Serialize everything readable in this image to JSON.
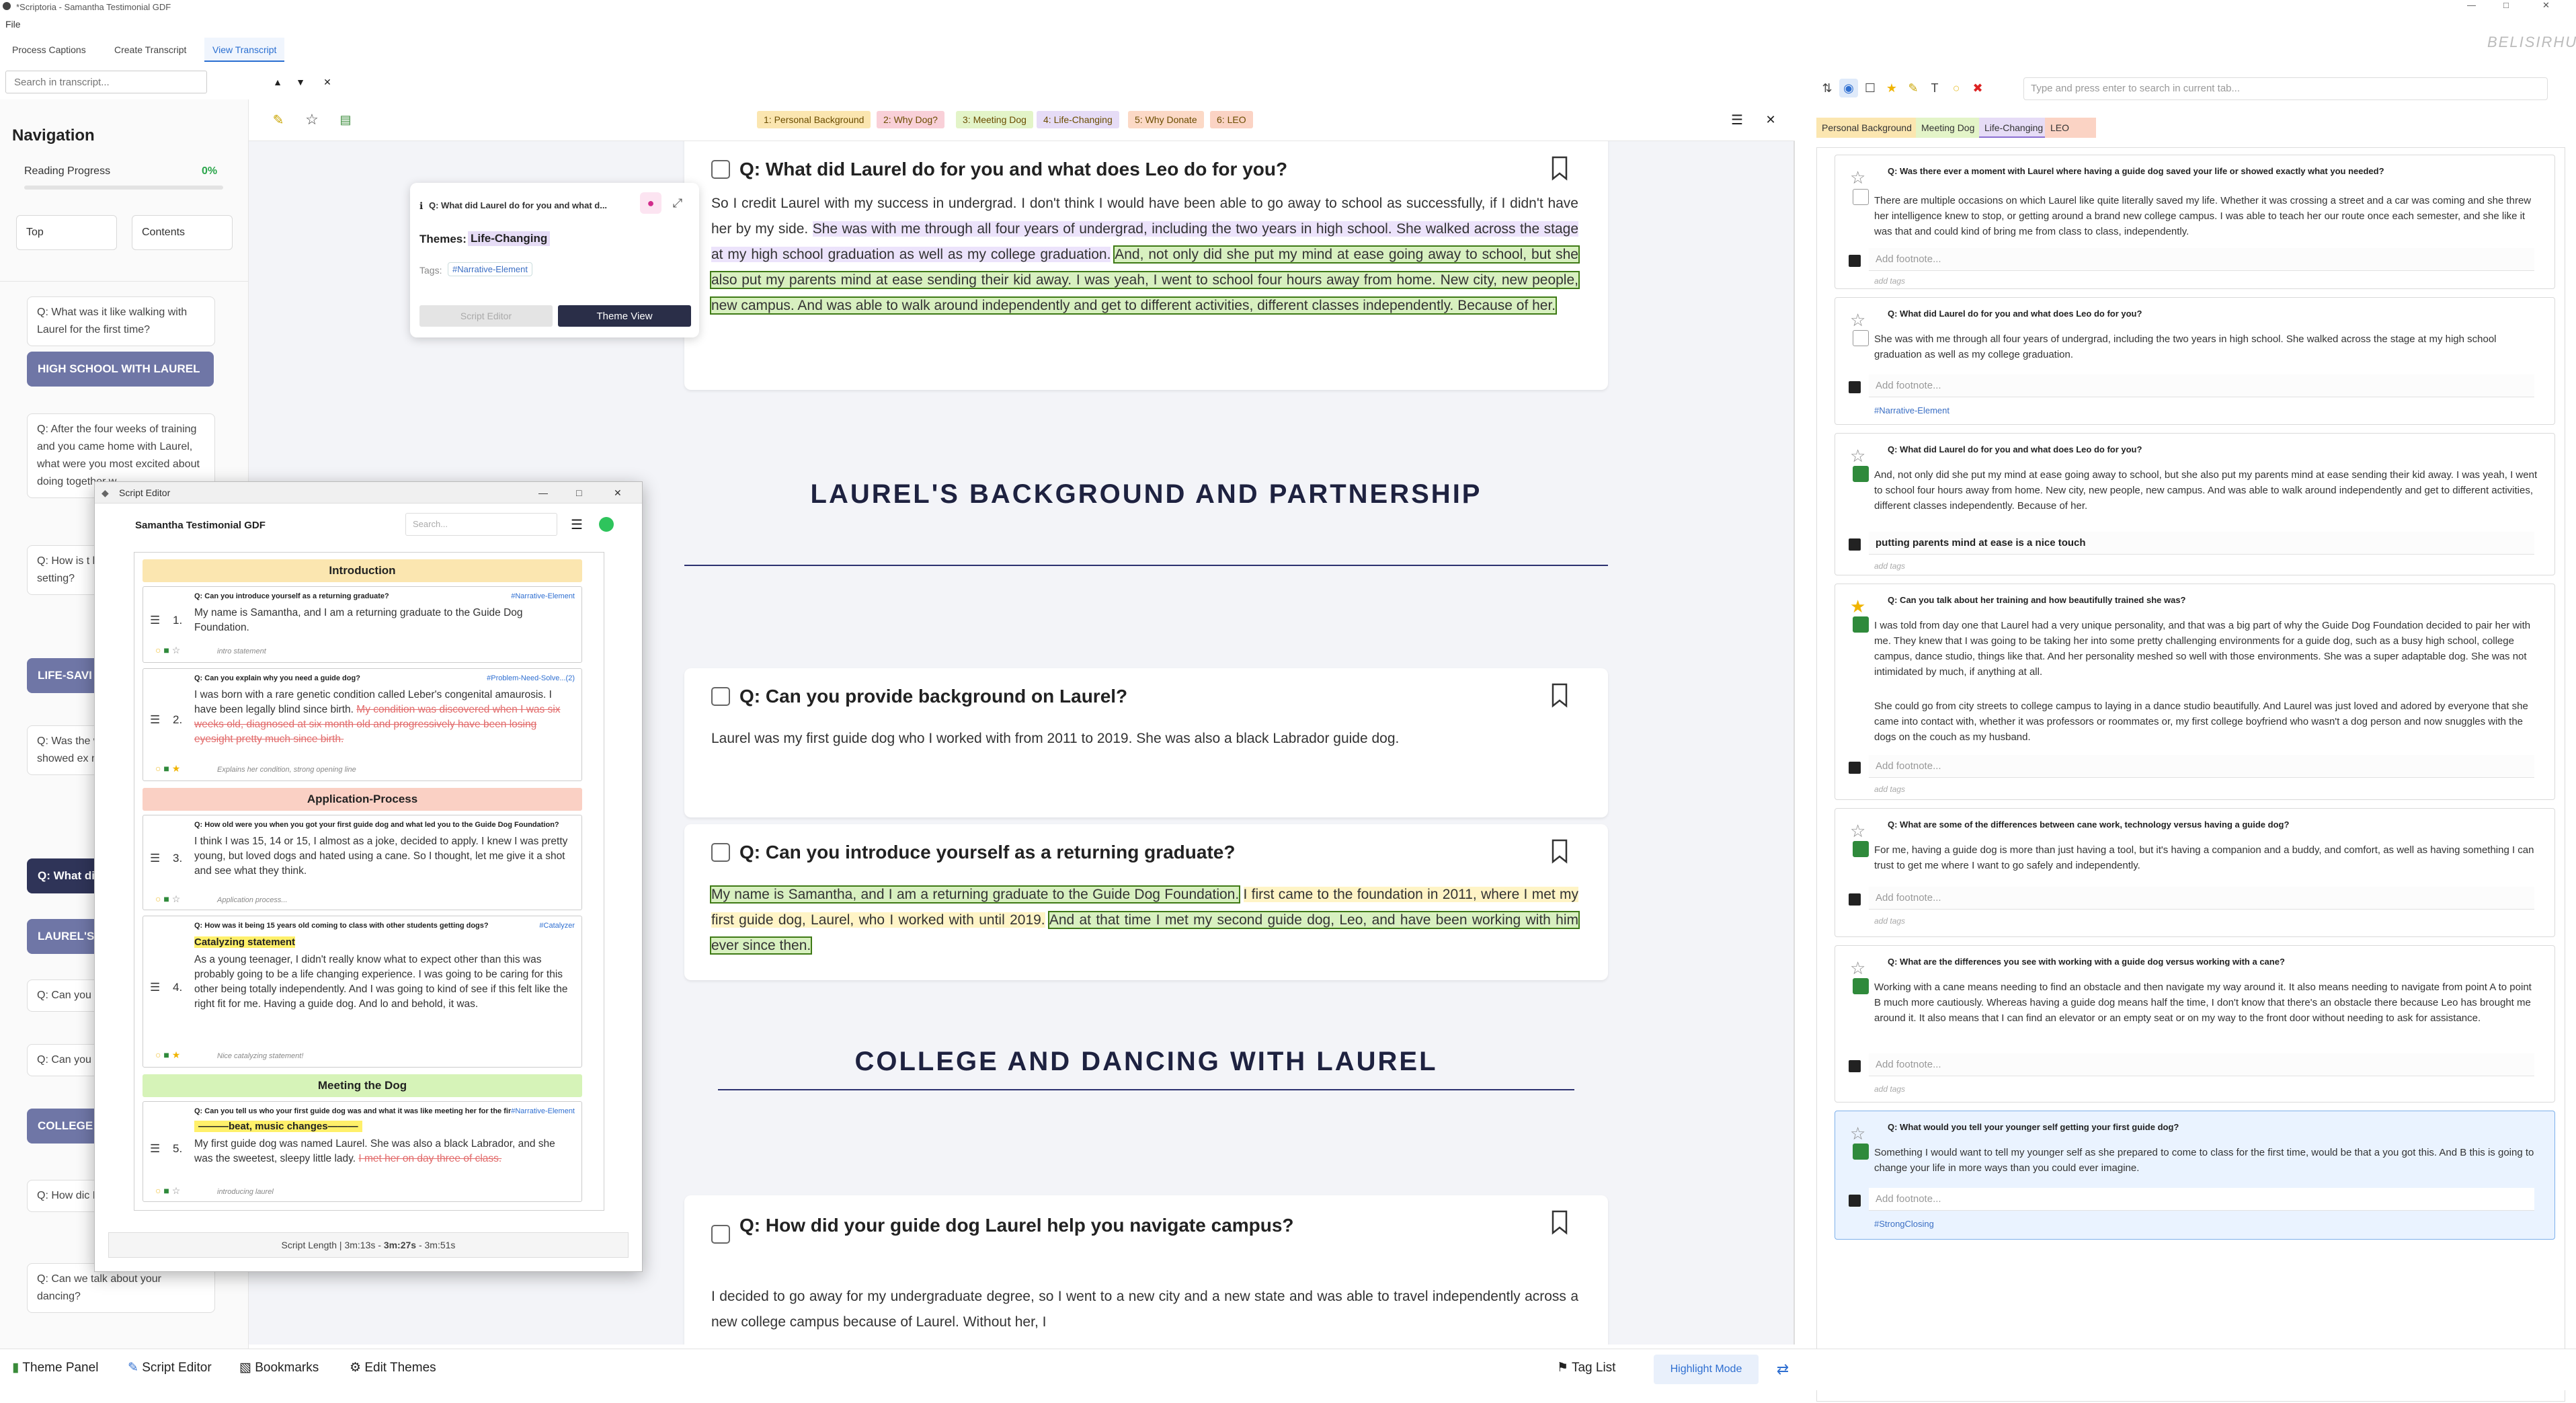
{
  "app": {
    "title": "*Scriptoria - Samantha Testimonial GDF",
    "menu_file": "File",
    "watermark": "BELISIRHUIA"
  },
  "tabs": [
    {
      "label": "Process Captions"
    },
    {
      "label": "Create Transcript"
    },
    {
      "label": "View Transcript"
    }
  ],
  "search": {
    "placeholder": "Search in transcript..."
  },
  "nav": {
    "title": "Navigation",
    "progress_label": "Reading Progress",
    "progress_value": "0%",
    "progress_fraction": 0,
    "top_label": "Top",
    "contents_label": "Contents",
    "items": [
      {
        "text": "Q: What was it like walking with Laurel for the first time?"
      },
      {
        "text": "HIGH SCHOOL WITH LAUREL"
      },
      {
        "text": "Q: After the four weeks of training and you came home with Laurel, what were you most excited about doing together w"
      },
      {
        "text": "Q: How is t between tr versus her setting?"
      },
      {
        "text": "LIFE-SAVI AND COLL"
      },
      {
        "text": "Q: Was the with Laurel guide dog showed ex needed?"
      },
      {
        "text": "Q: What di and what d"
      },
      {
        "text": "LAUREL'S AND PART"
      },
      {
        "text": "Q: Can you backgroun"
      },
      {
        "text": "Q: Can you as a return"
      },
      {
        "text": "COLLEGE WITH LAU"
      },
      {
        "text": "Q: How dic Laurel help campus?"
      },
      {
        "text": "Q: Can we talk about your dancing?"
      }
    ]
  },
  "toolbar": {
    "chips": [
      {
        "label": "1: Personal Background",
        "color": "#fbe6b0"
      },
      {
        "label": "2: Why Dog?",
        "color": "#f9d0d8"
      },
      {
        "label": "3: Meeting Dog",
        "color": "#e3f4c8"
      },
      {
        "label": "4: Life-Changing",
        "color": "#e6dcf6"
      },
      {
        "label": "5: Why Donate",
        "color": "#fcd9c6"
      },
      {
        "label": "6: LEO",
        "color": "#fbd3c4"
      }
    ]
  },
  "popover": {
    "question": "Q: What did Laurel do for you and what d...",
    "themes_label": "Themes:",
    "theme": "Life-Changing",
    "tags_label": "Tags:",
    "tag": "#Narrative-Element",
    "btn_script": "Script Editor",
    "btn_theme": "Theme View"
  },
  "transcript": {
    "card1": {
      "question": "Q: What did Laurel do for you and what does Leo do for you?",
      "text_a": "So I credit Laurel with my success in undergrad. I don't think I would have been able to go away to school as successfully, if I didn't have her by my side.",
      "text_b": "She was with me through all four years of undergrad, including the two years in high school. She walked across the stage at my high school graduation as well as my college graduation.",
      "text_c": "And, not only did she put my mind at ease going away to school, but she also put my parents mind at ease sending their kid away. I was yeah, I went to school four hours away from home. New city, new people, new campus. And was able to walk around independently and get to different activities, different classes independently. Because of her."
    },
    "section1": "LAUREL'S BACKGROUND AND PARTNERSHIP",
    "card2": {
      "question": "Q: Can you provide background on Laurel?",
      "text": "Laurel was my first guide dog who I worked with from 2011 to 2019. She was also a black Labrador guide dog."
    },
    "card3": {
      "question": "Q: Can you introduce yourself as a returning graduate?",
      "text_a": "My name is Samantha, and I am a returning graduate to the Guide Dog Foundation.",
      "text_b": "I first came to the foundation in 2011, where I met my first guide dog, Laurel, who I worked with until 2019.",
      "text_c": "And at that time I met my second guide dog, Leo, and have been working with him ever since then."
    },
    "section2": "COLLEGE AND DANCING WITH LAUREL",
    "card4": {
      "question": "Q: How did your guide dog Laurel help you navigate campus?",
      "text": "I decided to go away for my undergraduate degree, so I went to a new city and a new state and was able to travel independently across a new college campus because of Laurel. Without her, I"
    }
  },
  "right_panel": {
    "search_placeholder": "Type and press enter to search in current tab...",
    "tabs": [
      {
        "label": "Personal Background",
        "color": "#fbe6b0"
      },
      {
        "label": "Meeting Dog",
        "color": "#e3f4c8"
      },
      {
        "label": "Life-Changing",
        "color": "#e6dcf6"
      },
      {
        "label": "LEO",
        "color": "#fbd3c4"
      }
    ],
    "footnote_placeholder": "Add footnote...",
    "add_tags": "add tags",
    "cards": [
      {
        "q": "Q: Was there ever a moment with Laurel where having a guide dog saved your life or showed exactly what you needed?",
        "a": "There are multiple occasions on which Laurel like quite literally saved my life. Whether it was crossing a street and a car was coming and she threw her intelligence knew to stop, or getting around a brand new college campus. I was able to teach her our route once each semester, and she like it was that and could kind of bring me from class to class, independently.",
        "footnote": "",
        "tag": ""
      },
      {
        "q": "Q: What did Laurel do for you and what does Leo do for you?",
        "a": "She was with me through all four years of undergrad, including the two years in high school. She walked across the stage at my high school graduation as well as my college graduation.",
        "footnote": "",
        "tag": "#Narrative-Element"
      },
      {
        "q": "Q: What did Laurel do for you and what does Leo do for you?",
        "a": "And, not only did she put my mind at ease going away to school, but she also put my parents mind at ease sending their kid away. I was yeah, I went to school four hours away from home. New city, new people, new campus. And was able to walk around independently and get to different activities, different classes independently. Because of her.",
        "footnote": "putting parents mind at ease is a nice touch",
        "tag": ""
      },
      {
        "q": "Q: Can you talk about her training and how beautifully trained she was?",
        "a": "I was told from day one that Laurel had a very unique personality, and that was a big part of why the Guide Dog Foundation decided to pair her with me. They knew that I was going to be taking her into some pretty challenging environments for a guide dog, such as a busy high school, college campus, dance studio, things like that. And her personality meshed so well with those environments. She was a super adaptable dog. She was not intimidated by much, if anything at all.",
        "a2": "She could go from city streets to college campus to laying in a dance studio beautifully. And Laurel was just loved and adored by everyone that she came into contact with, whether it was professors or roommates or, my first college boyfriend who wasn't a dog person and now snuggles with the dogs on the couch as my husband.",
        "footnote": "",
        "tag": ""
      },
      {
        "q": "Q: What are some of the differences between cane work, technology versus having a guide dog?",
        "a": "For me, having a guide dog is more than just having a tool, but it's having a companion and a buddy, and comfort, as well as having something I can trust to get me where I want to go safely and independently.",
        "footnote": "",
        "tag": ""
      },
      {
        "q": "Q: What are the differences you see with working with a guide dog versus working with a cane?",
        "a": "Working with a cane means needing to find an obstacle and then navigate my way around it. It also means needing to navigate from point A to point B much more cautiously. Whereas having a guide dog means half the time, I don't know that there's an obstacle there because Leo has brought me around it. It also means that I can find an elevator or an empty seat or on my way to the front door without needing to ask for assistance.",
        "footnote": "",
        "tag": ""
      },
      {
        "q": "Q: What would you tell your younger self getting your first guide dog?",
        "a": "Something I would want to tell my younger self as she prepared to come to class for the first time, would be that a you got this. And B this is going to change your life in more ways than you could ever imagine.",
        "footnote": "",
        "tag": "#StrongClosing"
      }
    ]
  },
  "bottom": {
    "theme_panel": "Theme Panel",
    "script_editor": "Script Editor",
    "bookmarks": "Bookmarks",
    "edit_themes": "Edit Themes",
    "tag_list": "Tag List",
    "highlight_mode": "Highlight Mode"
  },
  "script_editor": {
    "window_title": "Script Editor",
    "doc_title": "Samantha Testimonial GDF",
    "search_placeholder": "Search...",
    "sections": [
      {
        "label": "Introduction",
        "color": "#fbe6b0"
      },
      {
        "label": "Application-Process",
        "color": "#fad0c4"
      },
      {
        "label": "Meeting the Dog",
        "color": "#d6f3b8"
      }
    ],
    "items": [
      {
        "num": "1.",
        "q": "Q: Can you introduce yourself as a returning graduate?",
        "tag": "#Narrative-Element",
        "text": "My name is Samantha, and I am a returning graduate to the Guide Dog Foundation.",
        "note": "intro statement"
      },
      {
        "num": "2.",
        "q": "Q: Can you explain why you need a guide dog?",
        "tag": "#Problem-Need-Solve...(2)",
        "text": "I was born with a rare genetic condition called Leber's congenital amaurosis. I have been legally blind since birth.",
        "strike": "My condition was discovered when I was six weeks old, diagnosed at six month old and progressively have been losing eyesight pretty much since birth.",
        "note": "Explains her condition, strong opening line"
      },
      {
        "num": "3.",
        "q": "Q: How old were you when you got your first guide dog and what led you to the Guide Dog Foundation?",
        "tag": "",
        "text": "I was pretty young, but loved dogs and hated using a cane. So I thought, let me give it a shot and see what they think.",
        "text_pre": "I think I was 15, 14 or 15, I almost as a joke, decided to apply. I knew",
        "note": "Application process..."
      },
      {
        "num": "4.",
        "q": "Q: How was it being 15 years old coming to class with other students getting dogs?",
        "tag": "#Catalyzer",
        "highlight": "Catalyzing statement",
        "text": "As a young teenager, I didn't really know what to expect other than this was probably going to be a life changing experience. I was going to be caring for this other being totally independently. And I was going to kind of see if this felt like the right fit for me. Having a guide dog. And lo and behold, it was.",
        "note": "Nice catalyzing statement!"
      },
      {
        "num": "5.",
        "q": "Q: Can you tell us who your first guide dog was and what it was like meeting her for the first time?",
        "tag": "#Narrative-Element",
        "highlight": "beat, music changes",
        "text": "My first guide dog was named Laurel. She was also a black Labrador, and she was the sweetest, sleepy little lady.",
        "strike": "I met her on day three of class.",
        "note": "introducing laurel"
      }
    ],
    "footer_pre": "Script Length | 3m:13s - ",
    "footer_mid": "3m:27s",
    "footer_post": " - 3m:51s"
  }
}
